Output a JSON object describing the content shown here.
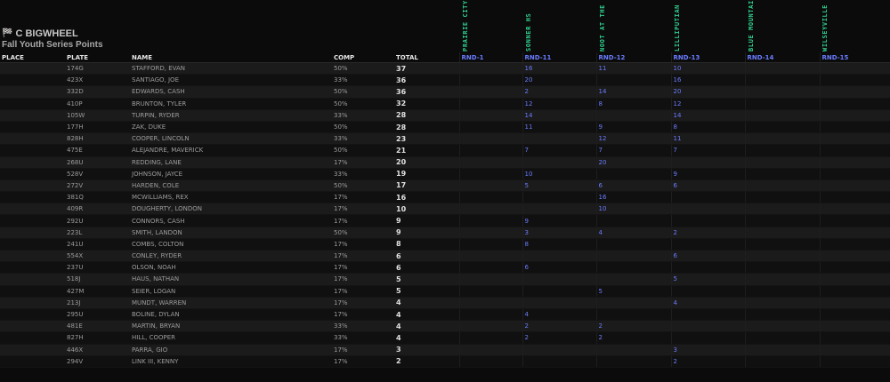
{
  "header": {
    "flag_icon": "checkered-flag-icon",
    "class_name": "C BIGWHEEL",
    "series_title": "Fall Youth Series Points"
  },
  "round_names": [
    "PRAIRIE CITY GP",
    "SONNER HS",
    "NOOT AT THE RIVER",
    "LILLIPUTIAN HS",
    "BLUE MOUNTAIN H",
    "WILSEYVILLE HS"
  ],
  "columns": {
    "place": "PLACE",
    "plate": "PLATE",
    "name": "NAME",
    "comp": "COMP",
    "total": "TOTAL",
    "rounds": [
      "RND-1",
      "RND-11",
      "RND-12",
      "RND-13",
      "RND-14",
      "RND-15"
    ]
  },
  "rows": [
    {
      "plate": "174G",
      "name": "STAFFORD, EVAN",
      "comp": "50%",
      "total": "37",
      "r": [
        "",
        "16",
        "11",
        "10",
        "",
        ""
      ]
    },
    {
      "plate": "423X",
      "name": "SANTIAGO, JOE",
      "comp": "33%",
      "total": "36",
      "r": [
        "",
        "20",
        "",
        "16",
        "",
        ""
      ]
    },
    {
      "plate": "332D",
      "name": "EDWARDS, CASH",
      "comp": "50%",
      "total": "36",
      "r": [
        "",
        "2",
        "14",
        "20",
        "",
        ""
      ]
    },
    {
      "plate": "410P",
      "name": "BRUNTON, TYLER",
      "comp": "50%",
      "total": "32",
      "r": [
        "",
        "12",
        "8",
        "12",
        "",
        ""
      ]
    },
    {
      "plate": "105W",
      "name": "TURPIN, RYDER",
      "comp": "33%",
      "total": "28",
      "r": [
        "",
        "14",
        "",
        "14",
        "",
        ""
      ]
    },
    {
      "plate": "177H",
      "name": "ZAK, DUKE",
      "comp": "50%",
      "total": "28",
      "r": [
        "",
        "11",
        "9",
        "8",
        "",
        ""
      ]
    },
    {
      "plate": "828H",
      "name": "COOPER, LINCOLN",
      "comp": "33%",
      "total": "23",
      "r": [
        "",
        "",
        "12",
        "11",
        "",
        ""
      ]
    },
    {
      "plate": "475E",
      "name": "ALEJANDRE, MAVERICK",
      "comp": "50%",
      "total": "21",
      "r": [
        "",
        "7",
        "7",
        "7",
        "",
        ""
      ]
    },
    {
      "plate": "268U",
      "name": "REDDING, LANE",
      "comp": "17%",
      "total": "20",
      "r": [
        "",
        "",
        "20",
        "",
        "",
        ""
      ]
    },
    {
      "plate": "528V",
      "name": "JOHNSON, JAYCE",
      "comp": "33%",
      "total": "19",
      "r": [
        "",
        "10",
        "",
        "9",
        "",
        ""
      ]
    },
    {
      "plate": "272V",
      "name": "HARDEN, COLE",
      "comp": "50%",
      "total": "17",
      "r": [
        "",
        "5",
        "6",
        "6",
        "",
        ""
      ]
    },
    {
      "plate": "381Q",
      "name": "MCWILLIAMS, REX",
      "comp": "17%",
      "total": "16",
      "r": [
        "",
        "",
        "16",
        "",
        "",
        ""
      ]
    },
    {
      "plate": "409R",
      "name": "DOUGHERTY, LONDON",
      "comp": "17%",
      "total": "10",
      "r": [
        "",
        "",
        "10",
        "",
        "",
        ""
      ]
    },
    {
      "plate": "292U",
      "name": "CONNORS, CASH",
      "comp": "17%",
      "total": "9",
      "r": [
        "",
        "9",
        "",
        "",
        "",
        ""
      ]
    },
    {
      "plate": "223L",
      "name": "SMITH, LANDON",
      "comp": "50%",
      "total": "9",
      "r": [
        "",
        "3",
        "4",
        "2",
        "",
        ""
      ]
    },
    {
      "plate": "241U",
      "name": "COMBS, COLTON",
      "comp": "17%",
      "total": "8",
      "r": [
        "",
        "8",
        "",
        "",
        "",
        ""
      ]
    },
    {
      "plate": "554X",
      "name": "CONLEY, RYDER",
      "comp": "17%",
      "total": "6",
      "r": [
        "",
        "",
        "",
        "6",
        "",
        ""
      ]
    },
    {
      "plate": "237U",
      "name": "OLSON, NOAH",
      "comp": "17%",
      "total": "6",
      "r": [
        "",
        "6",
        "",
        "",
        "",
        ""
      ]
    },
    {
      "plate": "518J",
      "name": "HAUS, NATHAN",
      "comp": "17%",
      "total": "5",
      "r": [
        "",
        "",
        "",
        "5",
        "",
        ""
      ]
    },
    {
      "plate": "427M",
      "name": "SEIER, LOGAN",
      "comp": "17%",
      "total": "5",
      "r": [
        "",
        "",
        "5",
        "",
        "",
        ""
      ]
    },
    {
      "plate": "213J",
      "name": "MUNDT, WARREN",
      "comp": "17%",
      "total": "4",
      "r": [
        "",
        "",
        "",
        "4",
        "",
        ""
      ]
    },
    {
      "plate": "295U",
      "name": "BOLINE, DYLAN",
      "comp": "17%",
      "total": "4",
      "r": [
        "",
        "4",
        "",
        "",
        "",
        ""
      ]
    },
    {
      "plate": "481E",
      "name": "MARTIN, BRYAN",
      "comp": "33%",
      "total": "4",
      "r": [
        "",
        "2",
        "2",
        "",
        "",
        ""
      ]
    },
    {
      "plate": "827H",
      "name": "HILL, COOPER",
      "comp": "33%",
      "total": "4",
      "r": [
        "",
        "2",
        "2",
        "",
        "",
        ""
      ]
    },
    {
      "plate": "446X",
      "name": "PARRA, GIO",
      "comp": "17%",
      "total": "3",
      "r": [
        "",
        "",
        "",
        "3",
        "",
        ""
      ]
    },
    {
      "plate": "294V",
      "name": "LINK III, KENNY",
      "comp": "17%",
      "total": "2",
      "r": [
        "",
        "",
        "",
        "2",
        "",
        ""
      ]
    }
  ]
}
